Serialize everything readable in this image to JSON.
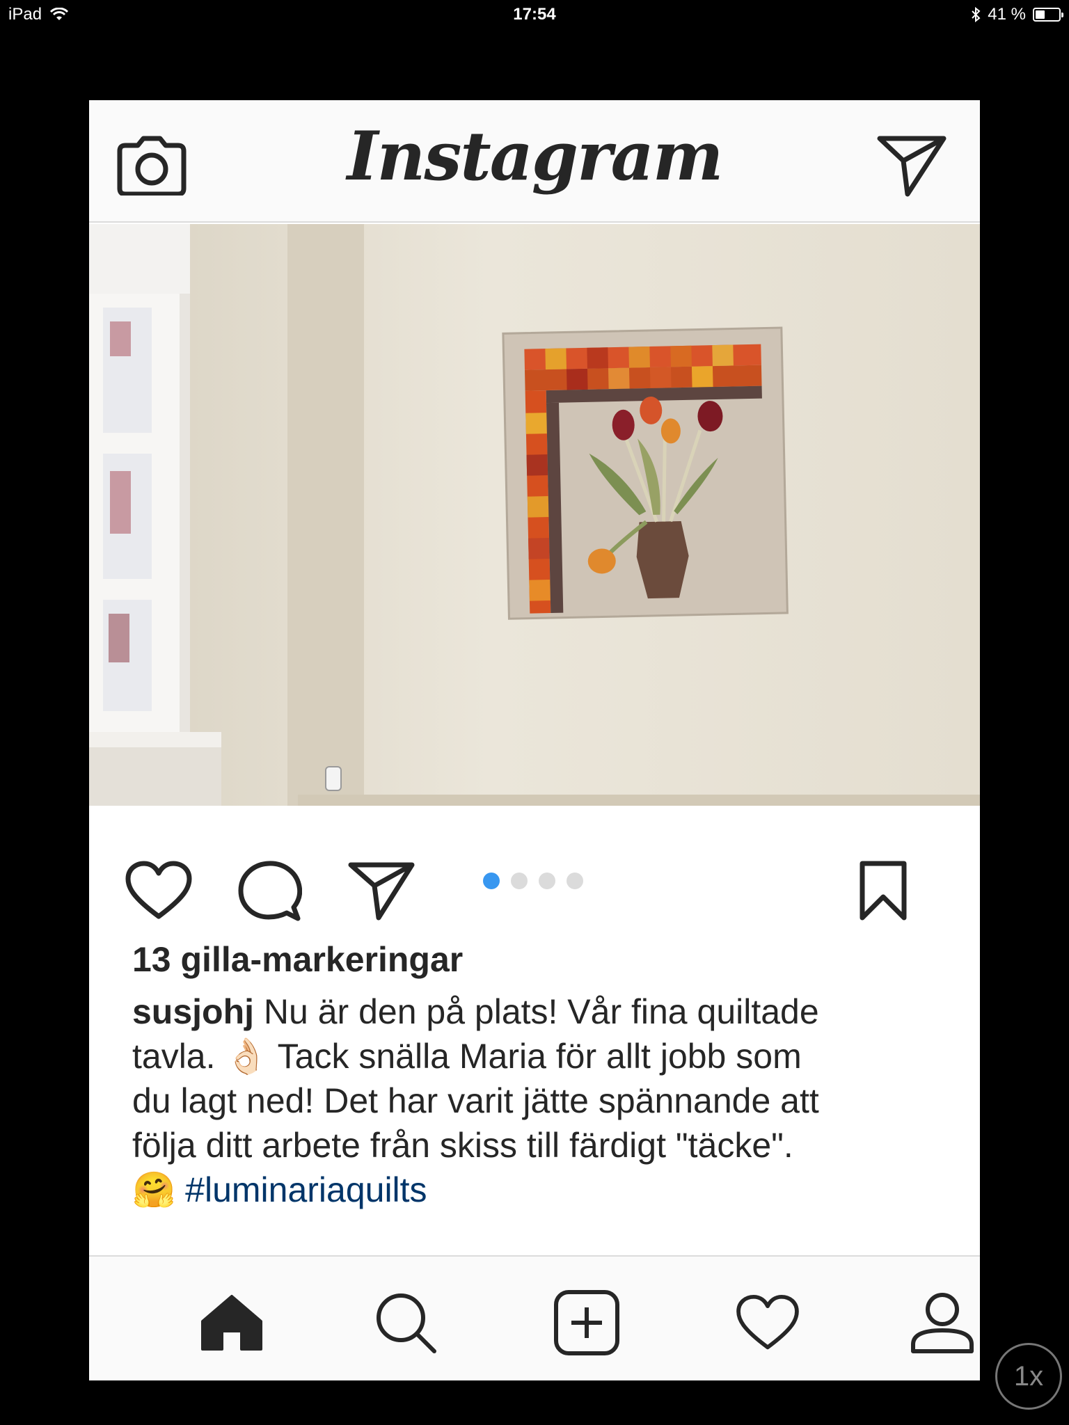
{
  "status_bar": {
    "device": "iPad",
    "time": "17:54",
    "battery_percent": "41 %",
    "battery_level": 0.41
  },
  "header": {
    "logo_text": "Instagram",
    "camera_icon": "camera-icon",
    "direct_icon": "paper-plane-icon"
  },
  "post": {
    "image_description_icons": [
      "quilt-wall-photo"
    ],
    "carousel": {
      "count": 4,
      "active_index": 0
    },
    "likes": "13 gilla-markeringar",
    "caption": {
      "username": "susjohj",
      "line1": " Nu är den på plats! Vår fina quiltade",
      "line2": "tavla. 👌🏻 Tack snälla Maria för allt jobb som",
      "line3": "du lagt ned! Det har varit jätte spännande att",
      "line4": "följa ditt arbete från skiss till färdigt \"täcke\".",
      "emoji": "🤗",
      "hashtag": "#luminariaquilts"
    }
  },
  "tabbar": {
    "items": [
      "home",
      "search",
      "add",
      "activity",
      "profile"
    ]
  },
  "zoom": "1x",
  "colors": {
    "accent_blue": "#3897f0",
    "hashtag": "#003569",
    "text": "#262626",
    "border": "#dbdbdb"
  }
}
